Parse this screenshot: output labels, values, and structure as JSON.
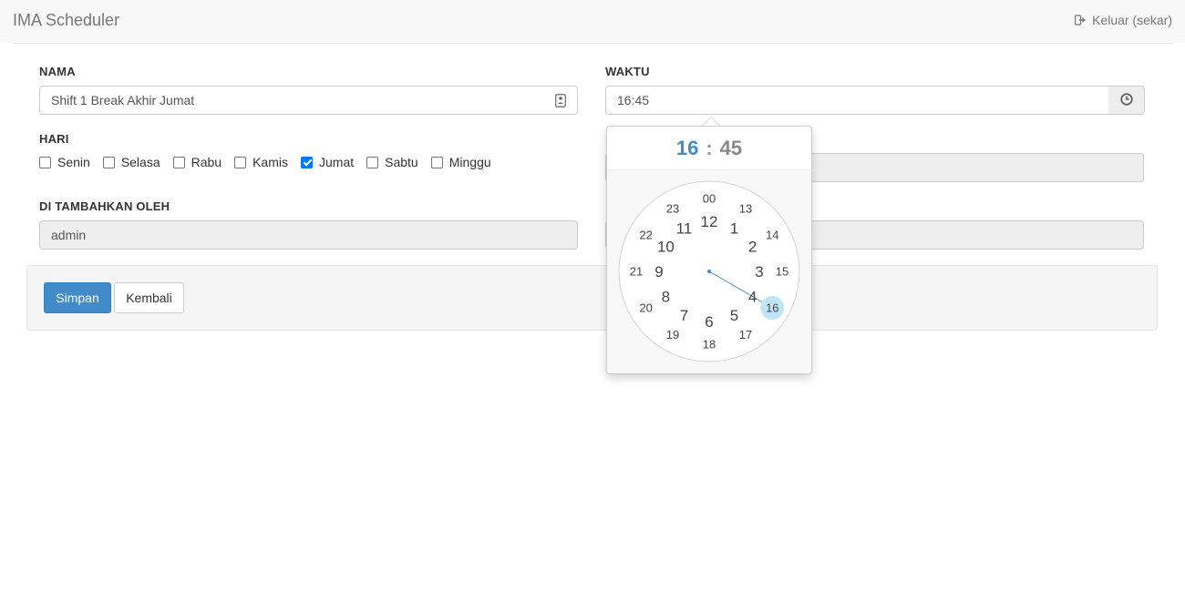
{
  "navbar": {
    "brand": "IMA Scheduler",
    "logout_label": "Keluar (sekar)",
    "logout_icon": "sign-out-icon"
  },
  "form": {
    "nama": {
      "label": "NAMA",
      "value": "Shift 1 Break Akhir Jumat",
      "icon": "contact-card-icon"
    },
    "waktu": {
      "label": "WAKTU",
      "value": "16:45",
      "icon": "clock-icon"
    },
    "hari": {
      "label": "HARI",
      "days": [
        {
          "label": "Senin",
          "checked": false
        },
        {
          "label": "Selasa",
          "checked": false
        },
        {
          "label": "Rabu",
          "checked": false
        },
        {
          "label": "Kamis",
          "checked": false
        },
        {
          "label": "Jumat",
          "checked": true
        },
        {
          "label": "Sabtu",
          "checked": false
        },
        {
          "label": "Minggu",
          "checked": false
        }
      ]
    },
    "ditambahkan_oleh": {
      "label": "DI TAMBAHKAN OLEH",
      "value": "admin"
    }
  },
  "buttons": {
    "save": "Simpan",
    "back": "Kembali"
  },
  "clockpicker": {
    "hours": "16",
    "separator": ":",
    "minutes": "45",
    "selected_hour": 16,
    "inner_numbers": [
      "12",
      "1",
      "2",
      "3",
      "4",
      "5",
      "6",
      "7",
      "8",
      "9",
      "10",
      "11"
    ],
    "outer_numbers": [
      "00",
      "13",
      "14",
      "15",
      "16",
      "17",
      "18",
      "19",
      "20",
      "21",
      "22",
      "23"
    ],
    "accent": "#428bca",
    "highlight": "#c0e5f7"
  }
}
